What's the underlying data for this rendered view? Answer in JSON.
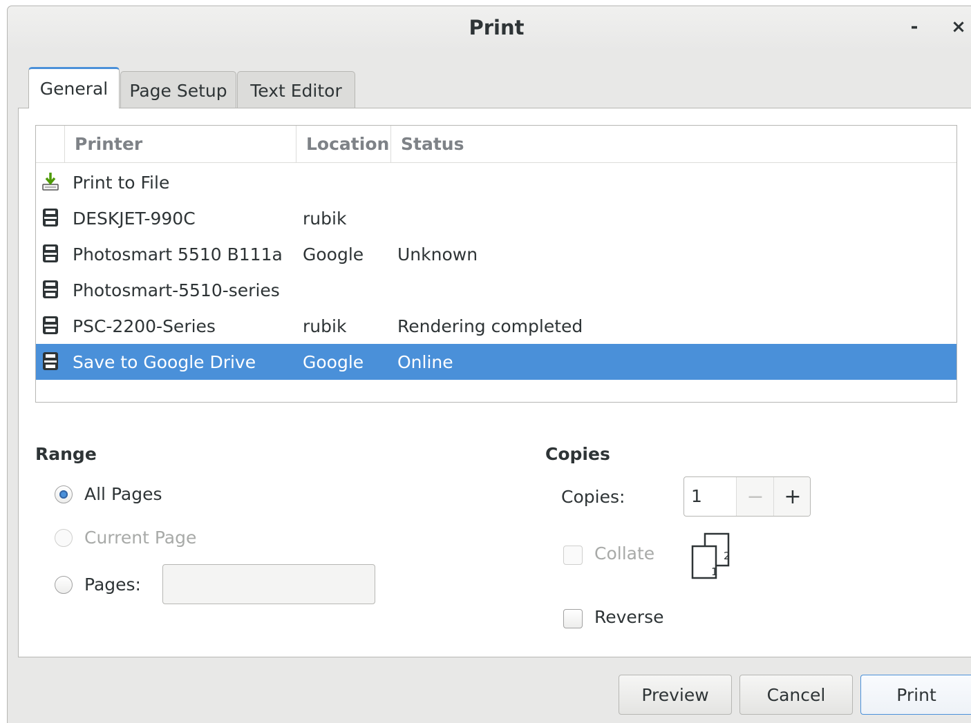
{
  "window": {
    "title": "Print",
    "minimize_glyph": "-",
    "close_glyph": "×"
  },
  "tabs": [
    {
      "label": "General",
      "active": true
    },
    {
      "label": "Page Setup",
      "active": false
    },
    {
      "label": "Text Editor",
      "active": false
    }
  ],
  "printer_list": {
    "columns": [
      "Printer",
      "Location",
      "Status"
    ],
    "rows": [
      {
        "icon": "print-to-file-icon",
        "name": "Print to File",
        "location": "",
        "status": "",
        "selected": false
      },
      {
        "icon": "printer-icon",
        "name": "DESKJET-990C",
        "location": "rubik",
        "status": "",
        "selected": false
      },
      {
        "icon": "printer-icon",
        "name": "Photosmart 5510 B111a",
        "location": "Google",
        "status": "Unknown",
        "selected": false
      },
      {
        "icon": "printer-icon",
        "name": "Photosmart-5510-series",
        "location": "",
        "status": "",
        "selected": false
      },
      {
        "icon": "printer-icon",
        "name": "PSC-2200-Series",
        "location": "rubik",
        "status": "Rendering completed",
        "selected": false
      },
      {
        "icon": "printer-icon",
        "name": "Save to Google Drive",
        "location": "Google",
        "status": "Online",
        "selected": true
      }
    ]
  },
  "range": {
    "title": "Range",
    "all_pages": "All Pages",
    "current_page": "Current Page",
    "pages": "Pages:",
    "pages_value": "",
    "selected": "all_pages"
  },
  "copies": {
    "title": "Copies",
    "copies_label": "Copies:",
    "copies_value": "1",
    "minus": "−",
    "plus": "+",
    "collate": "Collate",
    "collate_checked": false,
    "collate_icon_pages": [
      "1",
      "2"
    ],
    "reverse": "Reverse",
    "reverse_checked": false
  },
  "buttons": {
    "preview": "Preview",
    "cancel": "Cancel",
    "print": "Print"
  },
  "colors": {
    "accent": "#4a90d9",
    "window_bg": "#e8e8e7",
    "content_bg": "#ffffff",
    "text": "#2e3436",
    "disabled_text": "#a8aaa8"
  }
}
